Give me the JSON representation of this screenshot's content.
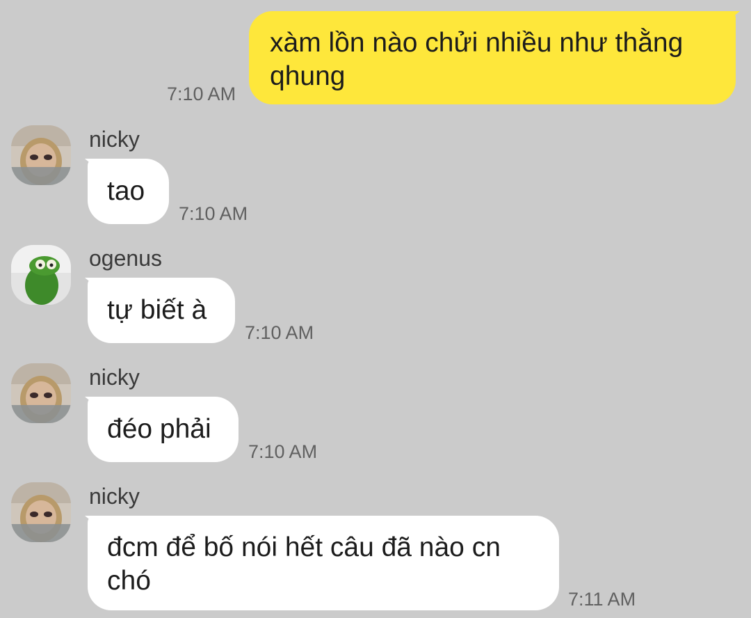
{
  "conversation": {
    "messages": [
      {
        "sender": "me",
        "text": "xàm lồn nào chửi nhiều như thằng qhung",
        "time": "7:10 AM"
      },
      {
        "sender": "nicky",
        "name": "nicky",
        "text": "tao",
        "time": "7:10 AM",
        "avatar_icon": "face-photo-avatar"
      },
      {
        "sender": "ogenus",
        "name": "ogenus",
        "text": "tự biết à",
        "time": "7:10 AM",
        "avatar_icon": "green-frog-avatar"
      },
      {
        "sender": "nicky",
        "name": "nicky",
        "text": "đéo phải",
        "time": "7:10 AM",
        "avatar_icon": "face-photo-avatar"
      },
      {
        "sender": "nicky",
        "name": "nicky",
        "text": "đcm để bố nói hết câu đã nào cn chó",
        "time": "7:11 AM",
        "avatar_icon": "face-photo-avatar"
      }
    ]
  },
  "colors": {
    "background": "#cbcbcb",
    "my_bubble": "#fee73b",
    "their_bubble": "#ffffff",
    "timestamp": "#606060"
  }
}
